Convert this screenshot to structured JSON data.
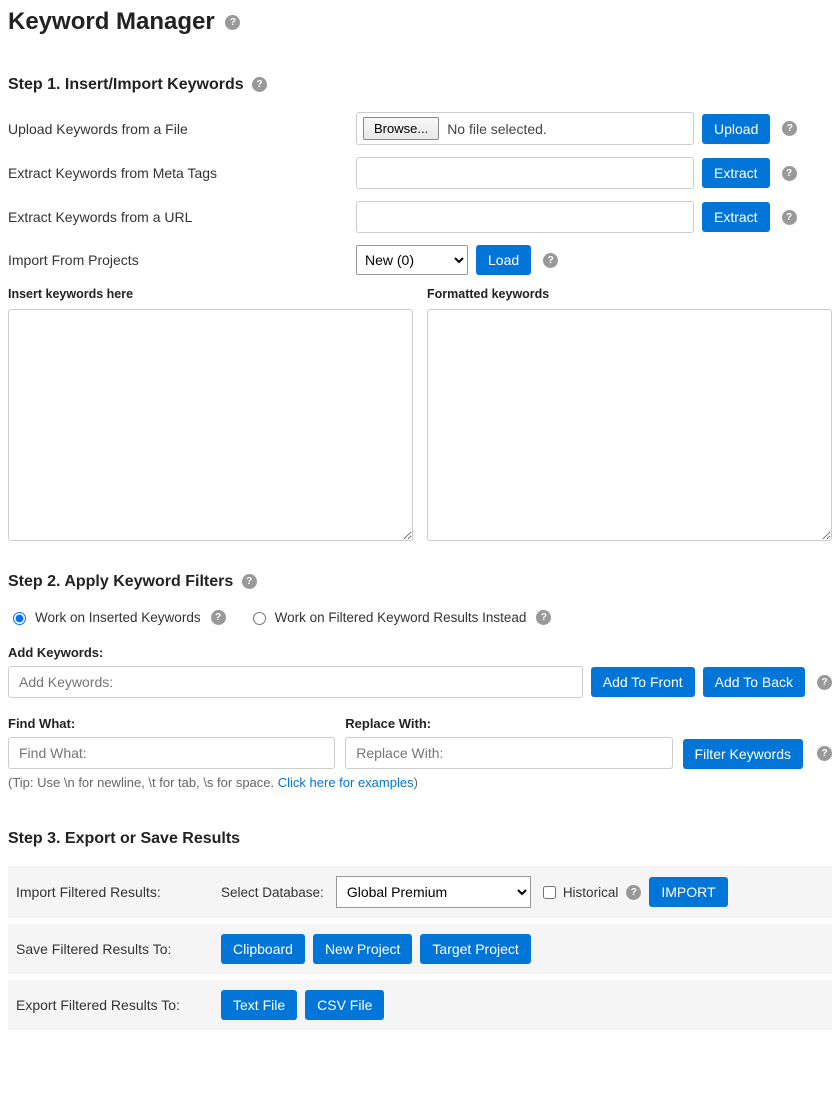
{
  "title": "Keyword Manager",
  "step1": {
    "heading": "Step 1. Insert/Import Keywords",
    "upload_label": "Upload Keywords from a File",
    "browse_btn": "Browse...",
    "no_file": "No file selected.",
    "upload_btn": "Upload",
    "meta_label": "Extract Keywords from Meta Tags",
    "extract_btn": "Extract",
    "url_label": "Extract Keywords from a URL",
    "projects_label": "Import From Projects",
    "projects_selected": "New (0)",
    "load_btn": "Load",
    "insert_here": "Insert keywords here",
    "formatted": "Formatted keywords"
  },
  "step2": {
    "heading": "Step 2. Apply Keyword Filters",
    "radio_inserted": "Work on Inserted Keywords",
    "radio_filtered": "Work on Filtered Keyword Results Instead",
    "add_keywords_label": "Add Keywords:",
    "add_keywords_placeholder": "Add Keywords:",
    "add_front_btn": "Add To Front",
    "add_back_btn": "Add To Back",
    "find_label": "Find What:",
    "find_placeholder": "Find What:",
    "replace_label": "Replace With:",
    "replace_placeholder": "Replace With:",
    "filter_btn": "Filter Keywords",
    "tip_text": "(Tip: Use \\n for newline, \\t for tab, \\s for space.  ",
    "tip_link": "Click here for examples",
    "tip_close": ")"
  },
  "step3": {
    "heading": "Step 3. Export or Save Results",
    "import_row_label": "Import Filtered Results:",
    "select_db_label": "Select Database:",
    "db_selected": "Global Premium",
    "historical_label": "Historical",
    "import_btn": "IMPORT",
    "save_row_label": "Save Filtered Results To:",
    "clipboard_btn": "Clipboard",
    "new_project_btn": "New Project",
    "target_project_btn": "Target Project",
    "export_row_label": "Export Filtered Results To:",
    "text_file_btn": "Text File",
    "csv_file_btn": "CSV File"
  }
}
